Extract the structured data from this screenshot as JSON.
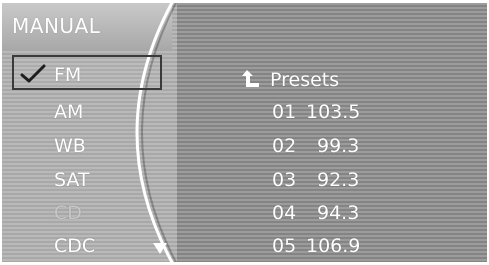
{
  "header": {
    "title": "MANUAL"
  },
  "bands": [
    {
      "label": "FM",
      "selected": true,
      "enabled": true
    },
    {
      "label": "AM",
      "selected": false,
      "enabled": true
    },
    {
      "label": "WB",
      "selected": false,
      "enabled": true
    },
    {
      "label": "SAT",
      "selected": false,
      "enabled": true
    },
    {
      "label": "CD",
      "selected": false,
      "enabled": false
    },
    {
      "label": "CDC",
      "selected": false,
      "enabled": true
    }
  ],
  "presets": {
    "label": "Presets",
    "items": [
      {
        "num": "01",
        "freq": "103.5"
      },
      {
        "num": "02",
        "freq": "99.3"
      },
      {
        "num": "03",
        "freq": "92.3"
      },
      {
        "num": "04",
        "freq": "94.3"
      },
      {
        "num": "05",
        "freq": "106.9"
      }
    ]
  },
  "icons": {
    "check": "check-icon",
    "back": "back-arrow-icon",
    "scroll": "scroll-down-triangle-icon"
  },
  "colors": {
    "text": "#ffffff",
    "frame": "#3a3a3a",
    "arc": "#ffffff"
  }
}
